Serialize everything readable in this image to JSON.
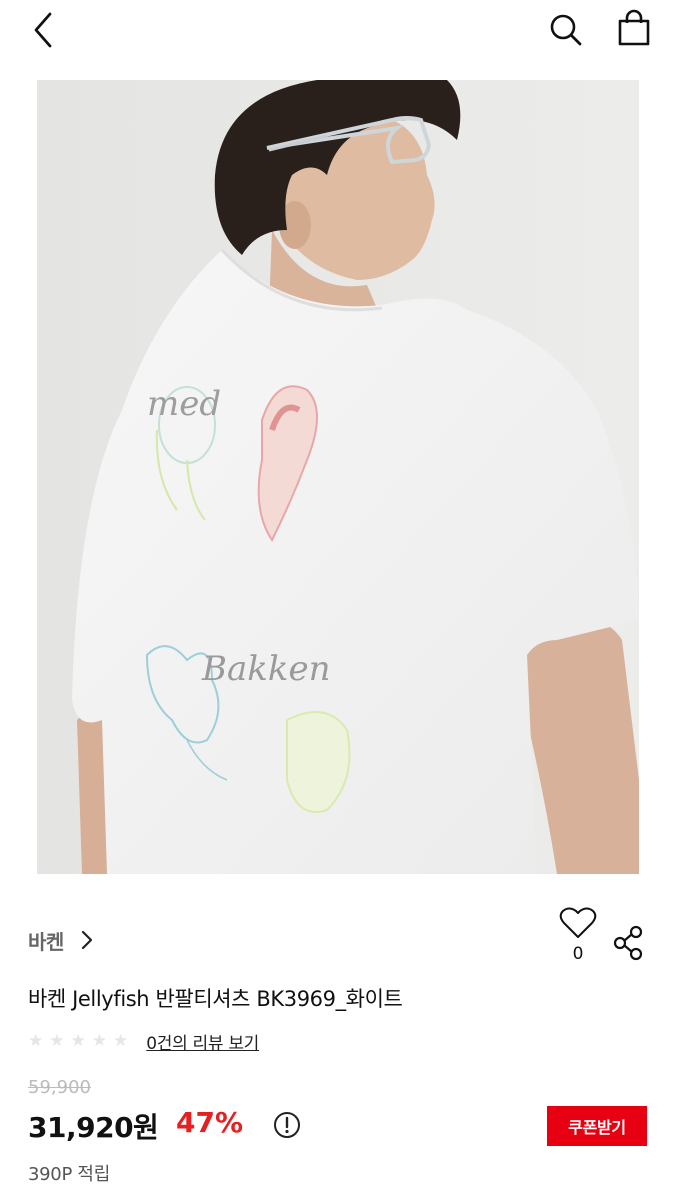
{
  "header": {
    "back_icon": "chevron-left-icon",
    "search_icon": "search-icon",
    "cart_icon": "shopping-bag-icon"
  },
  "product": {
    "image_logo_text": "Bakken",
    "image_script_text": "med",
    "brand": "바켄",
    "title": "바켄 Jellyfish 반팔티셔츠 BK3969_화이트",
    "likes": "0",
    "rating_stars": 0,
    "review_link": "0건의 리뷰 보기",
    "original_price": "59,900",
    "sale_price": "31,920원",
    "discount": "47%",
    "coupon_button": "쿠폰받기",
    "points": "390P 적립"
  },
  "colors": {
    "accent": "#e60012",
    "discount": "#e62020",
    "muted": "#bbbbbb"
  }
}
